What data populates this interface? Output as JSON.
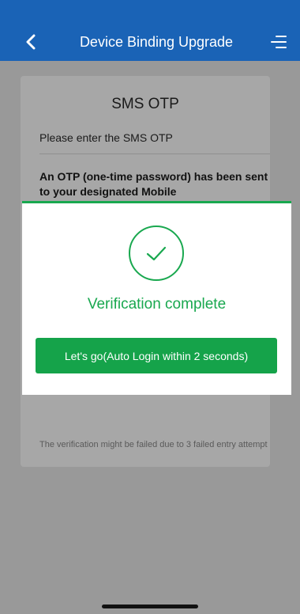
{
  "header": {
    "title": "Device Binding Upgrade",
    "back_icon": "chevron-left-icon",
    "menu_icon": "menu-icon",
    "color": "#1a63b6"
  },
  "card": {
    "title": "SMS OTP",
    "subtitle": "Please enter the SMS OTP",
    "otp_text": "An OTP (one-time password) has been sent to your designated Mobile",
    "note": "The verification might be failed due to 3 failed entry attempt"
  },
  "modal": {
    "icon": "check-circle-icon",
    "message": "Verification complete",
    "button_label": "Let's go(Auto Login within 2 seconds)",
    "accent": "#19a84f"
  }
}
